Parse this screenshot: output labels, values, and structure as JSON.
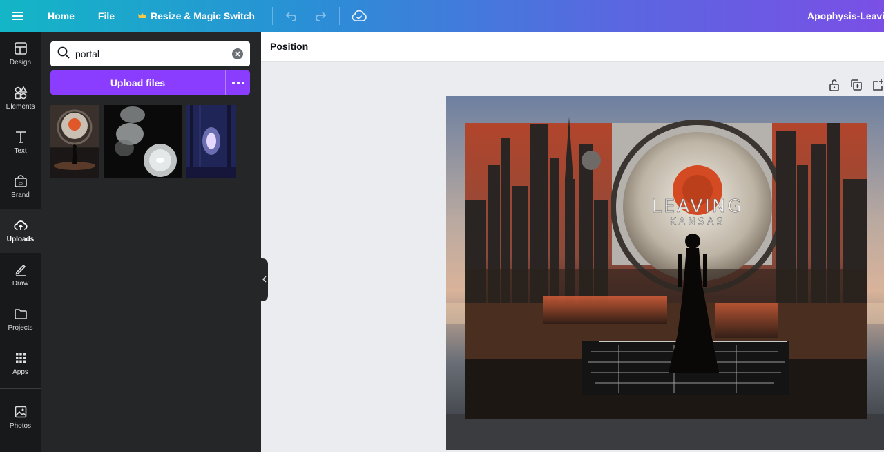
{
  "topbar": {
    "home": "Home",
    "file": "File",
    "resize": "Resize & Magic Switch",
    "title": "Apophysis-Leaving"
  },
  "rail": [
    {
      "label": "Design",
      "icon": "layout-icon"
    },
    {
      "label": "Elements",
      "icon": "shapes-icon"
    },
    {
      "label": "Text",
      "icon": "text-icon"
    },
    {
      "label": "Brand",
      "icon": "brand-icon"
    },
    {
      "label": "Uploads",
      "icon": "cloud-upload-icon",
      "active": true
    },
    {
      "label": "Draw",
      "icon": "pen-icon"
    },
    {
      "label": "Projects",
      "icon": "folder-icon"
    },
    {
      "label": "Apps",
      "icon": "grid-icon"
    },
    {
      "label": "Photos",
      "icon": "image-icon"
    }
  ],
  "panel": {
    "search_value": "portal",
    "upload_label": "Upload files"
  },
  "toolbar": {
    "position_label": "Position"
  },
  "artwork": {
    "title_line1": "LEAVING",
    "title_line2": "KANSAS"
  },
  "colors": {
    "accent": "#8b3dff",
    "panel_bg": "#252627",
    "rail_bg": "#18191b"
  }
}
